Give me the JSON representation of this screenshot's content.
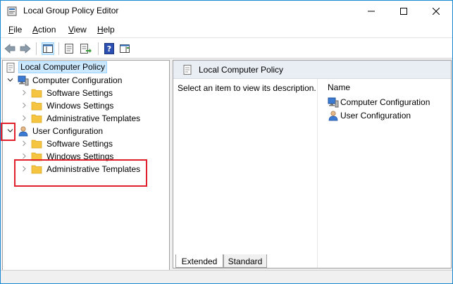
{
  "window": {
    "title": "Local Group Policy Editor",
    "minimize_icon": "minimize-icon",
    "maximize_icon": "maximize-icon",
    "close_icon": "close-icon"
  },
  "menu": {
    "items": [
      {
        "accel": "F",
        "rest": "ile"
      },
      {
        "accel": "A",
        "rest": "ction"
      },
      {
        "accel": "V",
        "rest": "iew"
      },
      {
        "accel": "H",
        "rest": "elp"
      }
    ]
  },
  "toolbar": {
    "buttons": [
      "back-arrow-icon",
      "forward-arrow-icon",
      "show-hide-tree-icon",
      "properties-icon",
      "export-list-icon",
      "help-icon",
      "show-hide-action-pane-icon"
    ]
  },
  "tree": {
    "root": {
      "label": "Local Computer Policy",
      "selected": true
    },
    "computer_config": {
      "label": "Computer Configuration",
      "children": [
        "Software Settings",
        "Windows Settings",
        "Administrative Templates"
      ]
    },
    "user_config": {
      "label": "User Configuration",
      "children": [
        "Software Settings",
        "Windows Settings",
        "Administrative Templates"
      ]
    }
  },
  "right_pane": {
    "header_title": "Local Computer Policy",
    "description": "Select an item to view its description.",
    "column_name": "Name",
    "items": [
      "Computer Configuration",
      "User Configuration"
    ]
  },
  "tabs": {
    "extended": "Extended",
    "standard": "Standard",
    "active": "Extended"
  },
  "colors": {
    "annotation": "#e0202a",
    "selection_bg": "#cce8ff",
    "folder": "#f5c542",
    "window_border": "#1a8ad4"
  }
}
